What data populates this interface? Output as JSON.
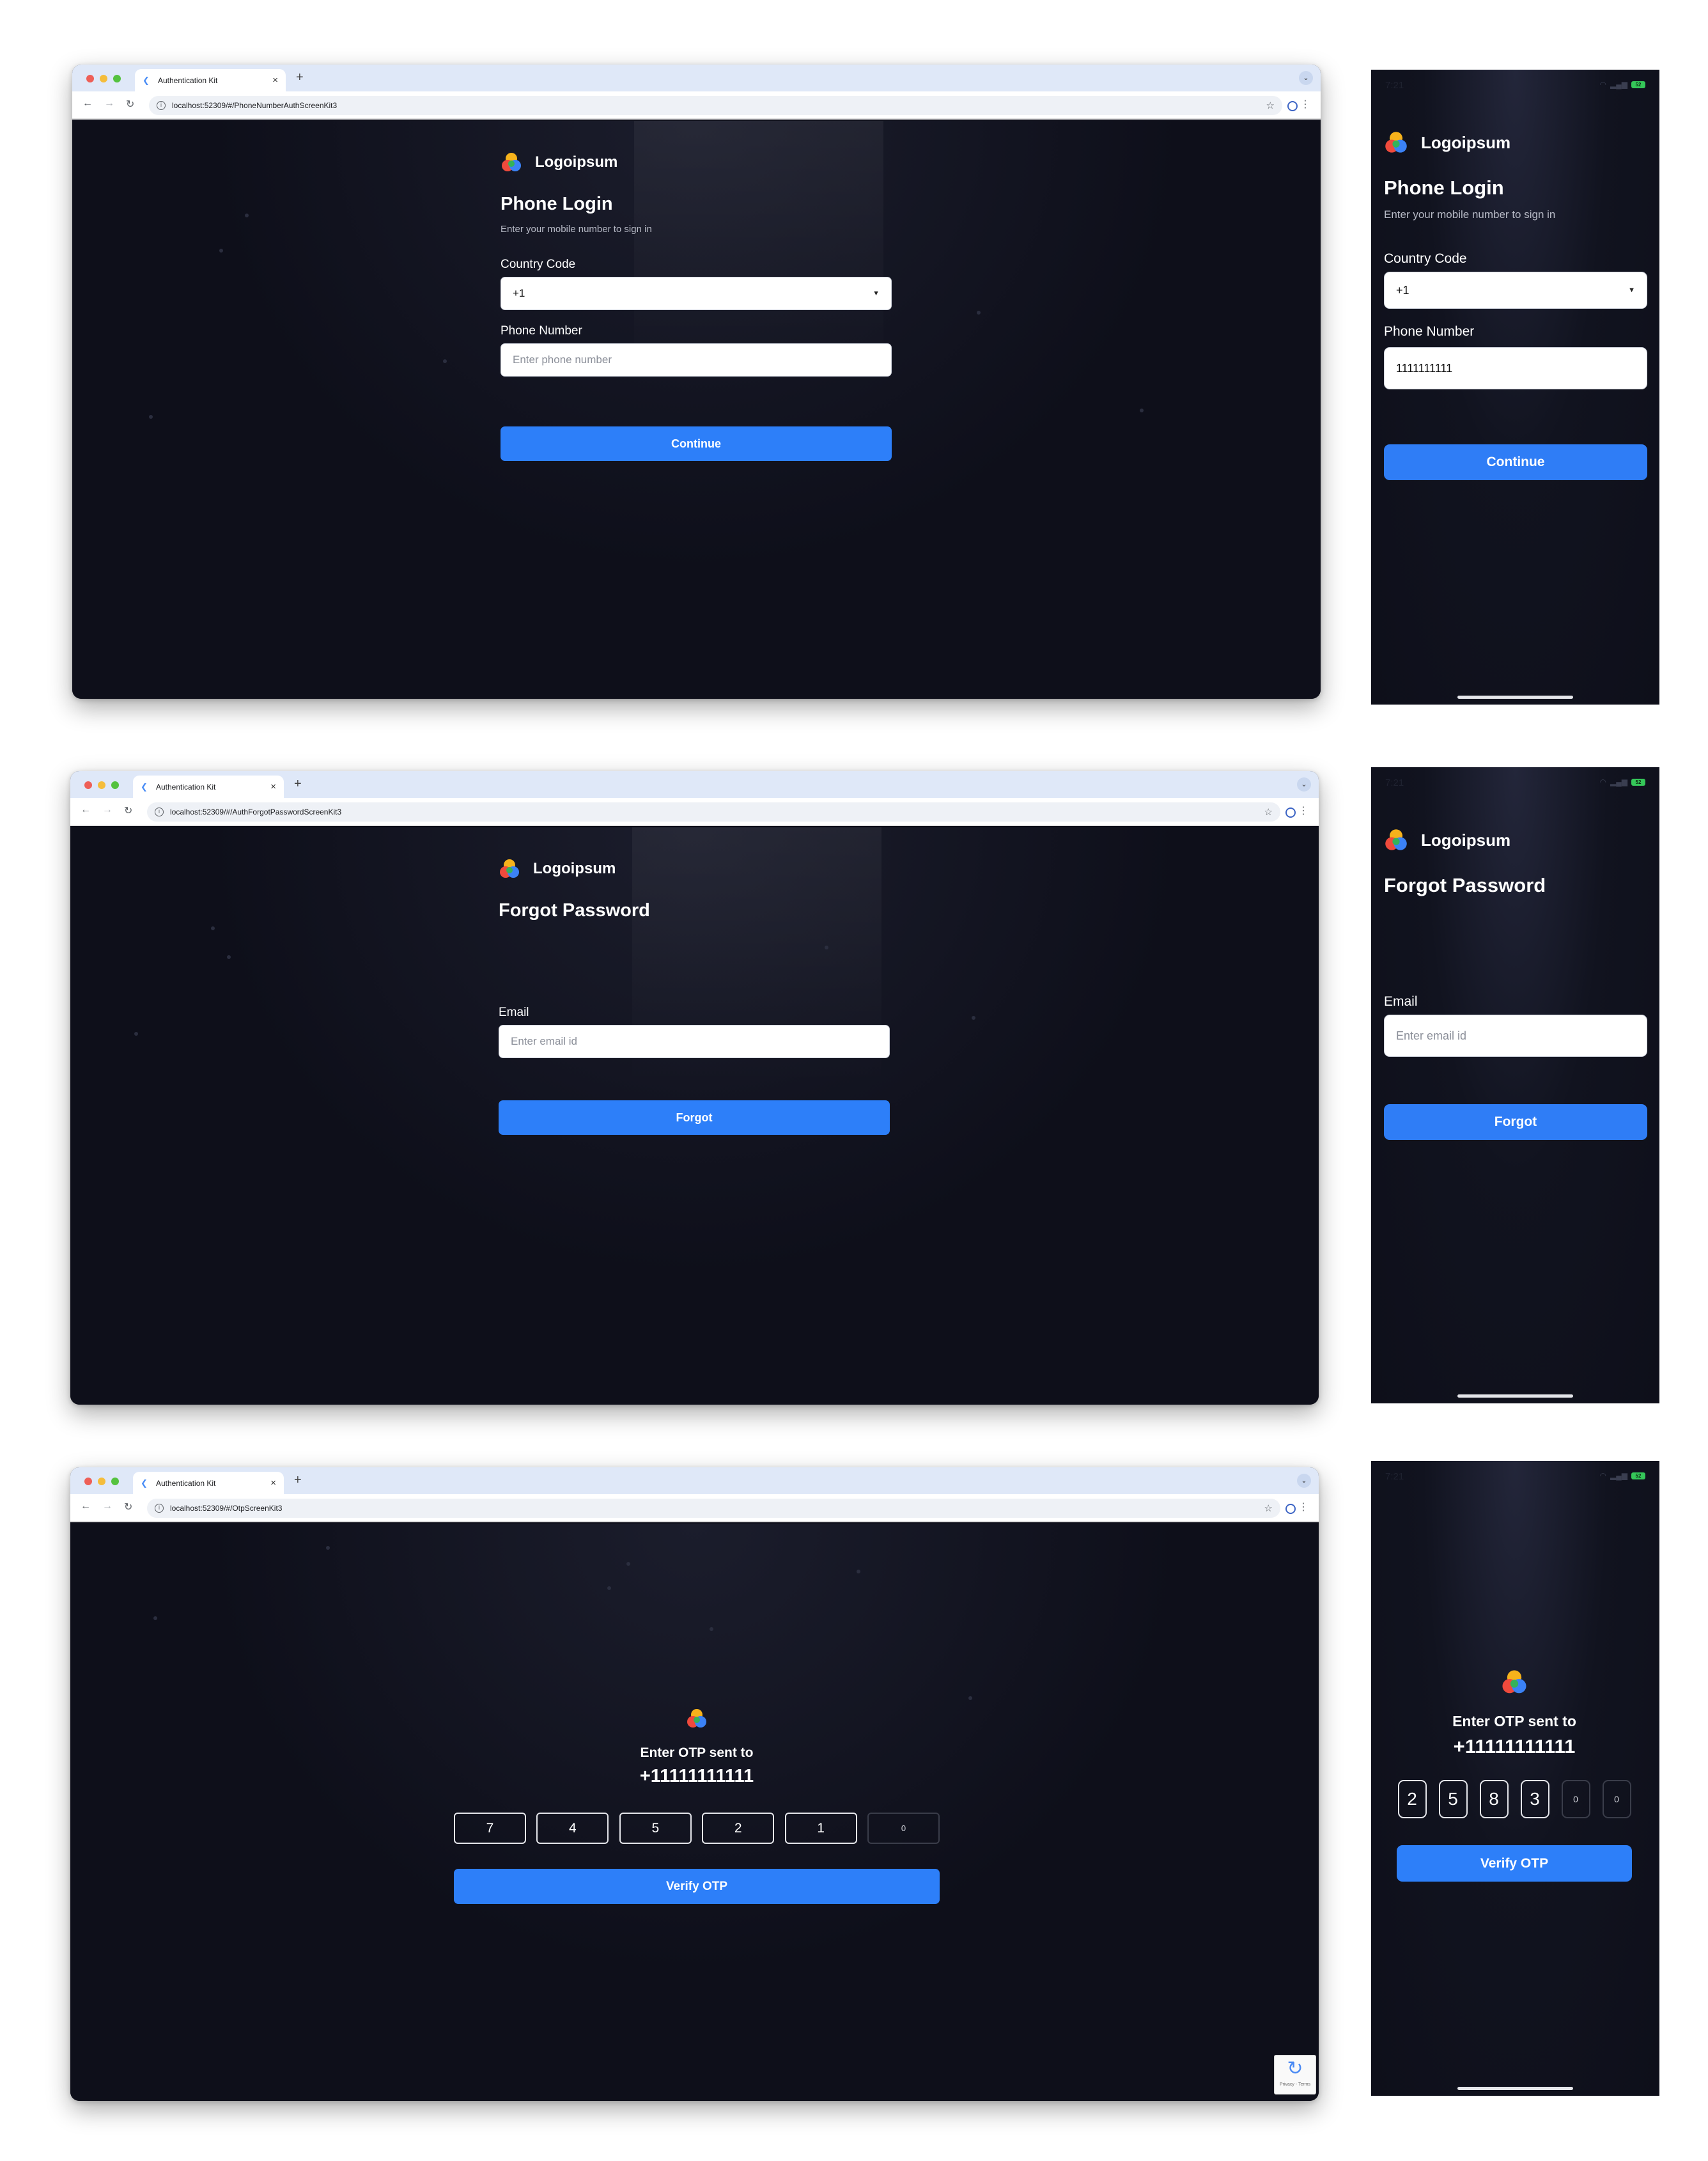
{
  "browser": {
    "tab_title": "Authentication Kit",
    "new_tab": "+",
    "close": "×",
    "back": "←",
    "forward": "→",
    "reload": "↻",
    "star": "☆",
    "menu": "⋮",
    "tab_menu": "⌄"
  },
  "screens": [
    {
      "url": "localhost:52309/#/PhoneNumberAuthScreenKit3",
      "brand": "Logoipsum",
      "title": "Phone Login",
      "subtitle": "Enter your mobile number to sign in",
      "country_label": "Country Code",
      "country_value": "+1",
      "phone_label": "Phone Number",
      "phone_placeholder": "Enter phone number",
      "button": "Continue",
      "mobile_phone_value": "1111111111"
    },
    {
      "url": "localhost:52309/#/AuthForgotPasswordScreenKit3",
      "brand": "Logoipsum",
      "title": "Forgot Password",
      "email_label": "Email",
      "email_placeholder": "Enter email id",
      "button": "Forgot"
    },
    {
      "url": "localhost:52309/#/OtpScreenKit3",
      "heading": "Enter OTP sent to",
      "phone": "+11111111111",
      "web_digits": [
        "7",
        "4",
        "5",
        "2",
        "1",
        "0"
      ],
      "mobile_digits": [
        "2",
        "5",
        "8",
        "3",
        "0",
        "0"
      ],
      "button": "Verify OTP"
    }
  ],
  "mobile_status": {
    "time": "7:21",
    "battery": "52"
  },
  "colors": {
    "background": "#0e0f1a",
    "accent": "#2d7ff9",
    "tabstrip": "#dfe8f8"
  }
}
